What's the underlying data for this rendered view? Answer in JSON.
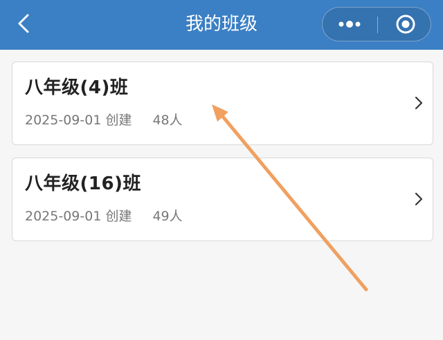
{
  "nav": {
    "title": "我的班级",
    "back_icon": "chevron-left-icon",
    "more_icon": "more-dots-icon",
    "close_icon": "target-circle-icon",
    "background_color": "#3b7fc4"
  },
  "classes": [
    {
      "name": "八年级(4)班",
      "created": "2025-09-01 创建",
      "count": "48人"
    },
    {
      "name": "八年级(16)班",
      "created": "2025-09-01 创建",
      "count": "49人"
    }
  ],
  "annotation": {
    "type": "arrow",
    "color": "#f0a060"
  }
}
